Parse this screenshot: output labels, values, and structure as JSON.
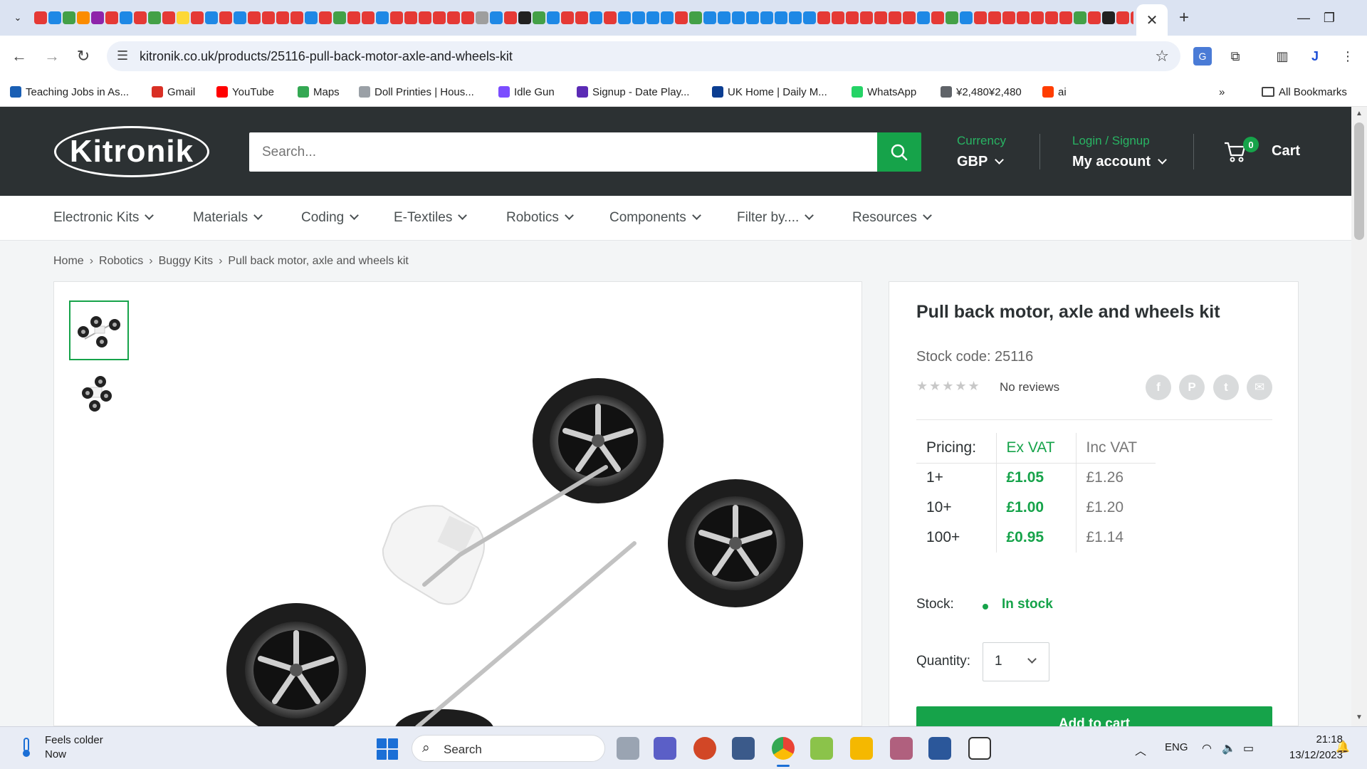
{
  "browser": {
    "tab_close": "✕",
    "new_tab": "+",
    "url": "kitronik.co.uk/products/25116-pull-back-motor-axle-and-wheels-kit",
    "bookmarks": [
      {
        "label": "Teaching Jobs in As...",
        "icon_color": "#1a5fb4"
      },
      {
        "label": "Gmail",
        "icon_color": "#d93025"
      },
      {
        "label": "YouTube",
        "icon_color": "#ff0000"
      },
      {
        "label": "Maps",
        "icon_color": "#34a853"
      },
      {
        "label": "Doll Printies | Hous...",
        "icon_color": "#9aa0a6"
      },
      {
        "label": "Idle Gun",
        "icon_color": "#7b4dff"
      },
      {
        "label": "Signup - Date Play...",
        "icon_color": "#5b2bb5"
      },
      {
        "label": "UK Home | Daily M...",
        "icon_color": "#0b3d91"
      },
      {
        "label": "WhatsApp",
        "icon_color": "#25d366"
      },
      {
        "label": "¥2,480¥2,480",
        "icon_color": "#5f6368"
      },
      {
        "label": "ai",
        "icon_color": "#ff3d00"
      }
    ],
    "all_bookmarks": "All Bookmarks",
    "tab_favicon_colors": [
      "#e53935",
      "#1e88e5",
      "#43a047",
      "#fb8c00",
      "#8e24aa",
      "#e53935",
      "#1e88e5",
      "#e53935",
      "#43a047",
      "#e53935",
      "#fdd835",
      "#e53935",
      "#1e88e5",
      "#e53935",
      "#1e88e5",
      "#e53935",
      "#e53935",
      "#e53935",
      "#e53935",
      "#1e88e5",
      "#e53935",
      "#43a047",
      "#e53935",
      "#e53935",
      "#1e88e5",
      "#e53935",
      "#e53935",
      "#e53935",
      "#e53935",
      "#e53935",
      "#e53935",
      "#9e9e9e",
      "#1e88e5",
      "#e53935",
      "#212121",
      "#43a047",
      "#1e88e5",
      "#e53935",
      "#e53935",
      "#1e88e5",
      "#e53935",
      "#1e88e5",
      "#1e88e5",
      "#1e88e5",
      "#1e88e5",
      "#e53935",
      "#43a047",
      "#1e88e5",
      "#1e88e5",
      "#1e88e5",
      "#1e88e5",
      "#1e88e5",
      "#1e88e5",
      "#1e88e5",
      "#1e88e5",
      "#e53935",
      "#e53935",
      "#e53935",
      "#e53935",
      "#e53935",
      "#e53935",
      "#e53935",
      "#1e88e5",
      "#e53935",
      "#43a047",
      "#1e88e5",
      "#e53935",
      "#e53935",
      "#e53935",
      "#e53935",
      "#e53935",
      "#e53935",
      "#e53935",
      "#43a047",
      "#e53935",
      "#212121",
      "#e53935",
      "#e53935",
      "#e53935",
      "#e53935",
      "#e53935",
      "#43a047"
    ]
  },
  "site": {
    "logo": "Kitronik",
    "search_placeholder": "Search...",
    "currency_label": "Currency",
    "currency_value": "GBP",
    "login_label": "Login / Signup",
    "account_label": "My account",
    "cart_count": "0",
    "cart_label": "Cart",
    "accent_color": "#16a34a"
  },
  "menu": [
    "Electronic Kits",
    "Materials",
    "Coding",
    "E-Textiles",
    "Robotics",
    "Components",
    "Filter by....",
    "Resources"
  ],
  "breadcrumb": [
    "Home",
    "Robotics",
    "Buggy Kits",
    "Pull back motor, axle and wheels kit"
  ],
  "product": {
    "title": "Pull back motor, axle and wheels kit",
    "stock_code": "Stock code: 25116",
    "stars": "★★★★★",
    "reviews": "No reviews",
    "social_icons": [
      "f",
      "P",
      "t",
      "✉"
    ],
    "pricing_header": [
      "Pricing:",
      "Ex VAT",
      "Inc VAT"
    ],
    "pricing_rows": [
      [
        "1+",
        "£1.05",
        "£1.26"
      ],
      [
        "10+",
        "£1.00",
        "£1.20"
      ],
      [
        "100+",
        "£0.95",
        "£1.14"
      ]
    ],
    "stock_label": "Stock:",
    "stock_value": "In stock",
    "quantity_label": "Quantity:",
    "quantity_value": "1",
    "add_to_cart": "Add to cart"
  },
  "taskbar": {
    "weather_line1": "Feels colder",
    "weather_line2": "Now",
    "search": "Search",
    "lang": "ENG",
    "time": "21:18",
    "date": "13/12/2023"
  }
}
